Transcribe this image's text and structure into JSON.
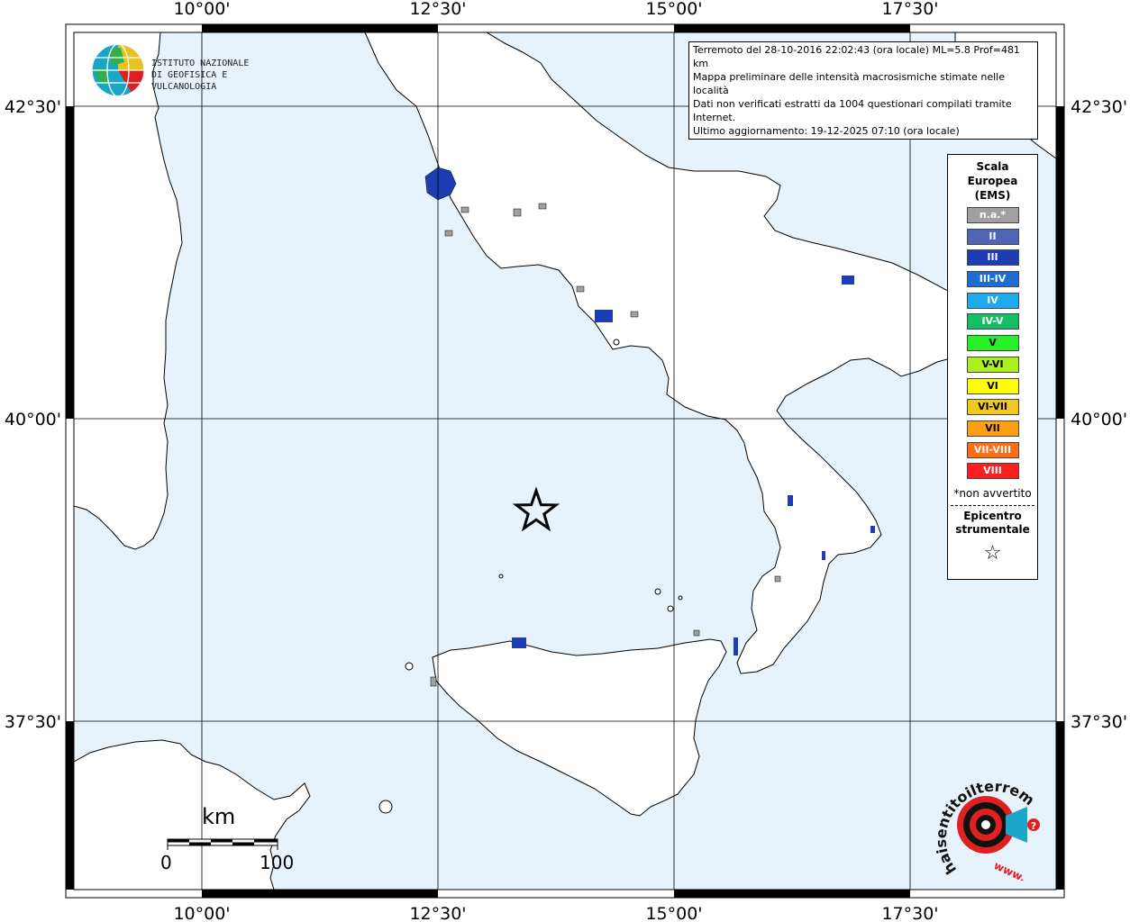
{
  "coordinates": {
    "lon_top": [
      "10°00'",
      "12°30'",
      "15°00'",
      "17°30'"
    ],
    "lon_bottom": [
      "10°00'",
      "12°30'",
      "15°00'",
      "17°30'"
    ],
    "lat_left": [
      "42°30'",
      "40°00'",
      "37°30'"
    ],
    "lat_right": [
      "42°30'",
      "40°00'",
      "37°30'"
    ]
  },
  "info_box": {
    "line1": "Terremoto del 28-10-2016 22:02:43 (ora locale) ML=5.8 Prof=481 km",
    "line2": "Mappa preliminare delle intensità macrosismiche stimate nelle località",
    "line3": "Dati non verificati estratti da 1004 questionari compilati tramite Internet.",
    "line4": "Ultimo aggiornamento: 19-12-2025 07:10 (ora locale)"
  },
  "ingv_logo": {
    "line1": "ISTITUTO NAZIONALE",
    "line2": "DI GEOFISICA E VULCANOLOGIA"
  },
  "legend": {
    "title_line1": "Scala",
    "title_line2": "Europea",
    "title_line3": "(EMS)",
    "items": [
      {
        "label": "n.a.*",
        "color": "#a0a0a0"
      },
      {
        "label": "II",
        "color": "#5066b4"
      },
      {
        "label": "III",
        "color": "#1e3cb4"
      },
      {
        "label": "III-IV",
        "color": "#1e6ed2"
      },
      {
        "label": "IV",
        "color": "#1eaaf0"
      },
      {
        "label": "IV-V",
        "color": "#14be64"
      },
      {
        "label": "V",
        "color": "#28f028"
      },
      {
        "label": "V-VI",
        "color": "#aaf01e"
      },
      {
        "label": "VI",
        "color": "#ffff00"
      },
      {
        "label": "VI-VII",
        "color": "#f0c81e"
      },
      {
        "label": "VII",
        "color": "#ffa014"
      },
      {
        "label": "VII-VIII",
        "color": "#ff6e14"
      },
      {
        "label": "VIII",
        "color": "#ff1e1e"
      }
    ],
    "note": "*non avvertito",
    "epicenter_line1": "Epicentro",
    "epicenter_line2": "strumentale",
    "epicenter_symbol": "☆"
  },
  "scale_bar": {
    "unit": "km",
    "min": "0",
    "max": "100"
  },
  "brand": {
    "text_main": "haisentitoilterremoto.it",
    "text_www": "www.",
    "question": "?"
  },
  "colors": {
    "sea": "#e6f2fc",
    "land": "#ffffff",
    "felt_blue": "#1e3cb4",
    "not_felt": "#a0a0a0"
  },
  "icons": {
    "epicenter": "star-icon",
    "logo": "globe-icon"
  }
}
